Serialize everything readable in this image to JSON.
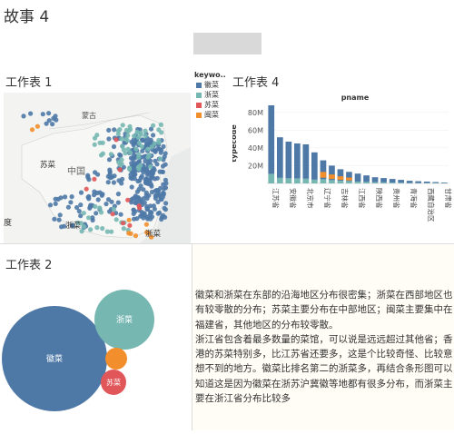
{
  "story": {
    "title": "故事 4"
  },
  "sheets": {
    "sheet1": {
      "title": "工作表 1"
    },
    "sheet2": {
      "title": "工作表 2"
    },
    "sheet4": {
      "title": "工作表 4"
    }
  },
  "colors": {
    "hui": "#4e79a7",
    "zhe": "#76b7b2",
    "su": "#e15759",
    "min": "#f28e2b",
    "map_bg": "#e9ebea",
    "land": "#f4f4f2"
  },
  "legend": {
    "title": "keywo..",
    "items": [
      {
        "label": "徽菜",
        "color": "#4e79a7"
      },
      {
        "label": "浙菜",
        "color": "#76b7b2"
      },
      {
        "label": "苏菜",
        "color": "#e15759"
      },
      {
        "label": "闽菜",
        "color": "#f28e2b"
      }
    ]
  },
  "map": {
    "labels": {
      "mongolia": "蒙古",
      "china": "中国",
      "su": "苏菜",
      "zhe": "浙菜",
      "left": "度"
    }
  },
  "chart_data": [
    {
      "type": "bar",
      "title": "pname",
      "xlabel": "",
      "ylabel": "typecode",
      "ylim": [
        0,
        90000000
      ],
      "yticks": [
        "20M",
        "40M",
        "60M",
        "80M"
      ],
      "yticks_values": [
        20000000,
        40000000,
        60000000,
        80000000
      ],
      "categories": [
        "江苏省",
        "",
        "安徽省",
        "",
        "北京市",
        "",
        "辽宁省",
        "",
        "吉林省",
        "",
        "江西省",
        "",
        "陕西省",
        "",
        "贵州省",
        "",
        "青海省",
        "",
        "西藏自治区",
        "",
        "甘肃省"
      ],
      "series": [
        {
          "name": "徽菜",
          "values": [
            88000000,
            52000000,
            47000000,
            45000000,
            44000000,
            35000000,
            26000000,
            20000000,
            16000000,
            13000000,
            11000000,
            9000000,
            7000000,
            6000000,
            5000000,
            4000000,
            3000000,
            2500000,
            2000000,
            1500000,
            1000000
          ]
        }
      ]
    },
    {
      "type": "bubble",
      "series": [
        {
          "name": "徽菜",
          "label": "徽菜",
          "value": 100
        },
        {
          "name": "浙菜",
          "label": "浙菜",
          "value": 38
        },
        {
          "name": "苏菜",
          "label": "苏菜",
          "value": 6
        },
        {
          "name": "闽菜",
          "label": "",
          "value": 5
        }
      ]
    }
  ],
  "description": {
    "paragraph1": "徽菜和浙菜在东部的沿海地区分布很密集；浙菜在西部地区也有较零散的分布；苏菜主要分布在中部地区；闽菜主要集中在福建省，其他地区的分布较零散。",
    "paragraph2": "浙江省包含着最多数量的菜馆，可以说是远远超过其他省；香港的苏菜特别多，比江苏省还要多，这是个比较奇怪、比较意想不到的地方。徽菜比排名第二的浙菜多，再结合条形图可以知道这是因为徽菜在浙苏沪冀徽等地都有很多分布，而浙菜主要在浙江省分布比较多"
  }
}
